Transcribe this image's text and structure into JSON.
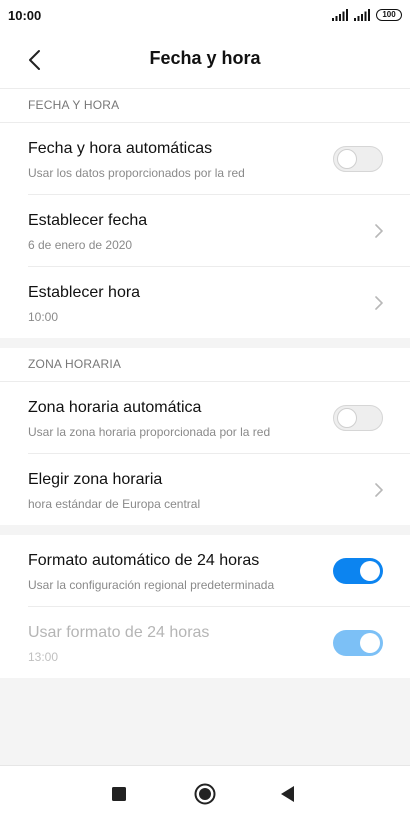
{
  "status_bar": {
    "time": "10:00",
    "battery": "100"
  },
  "header": {
    "title": "Fecha y hora",
    "back_icon": "chevron-left-icon"
  },
  "sections": {
    "date_time": {
      "header": "FECHA Y HORA",
      "auto_date_time": {
        "title": "Fecha y hora automáticas",
        "subtitle": "Usar los datos proporcionados por la red",
        "enabled": false
      },
      "set_date": {
        "title": "Establecer fecha",
        "value": "6 de enero de 2020"
      },
      "set_time": {
        "title": "Establecer hora",
        "value": "10:00"
      }
    },
    "time_zone": {
      "header": "ZONA HORARIA",
      "auto_time_zone": {
        "title": "Zona horaria automática",
        "subtitle": "Usar la zona horaria proporcionada por la red",
        "enabled": false
      },
      "choose_time_zone": {
        "title": "Elegir zona horaria",
        "value": "hora estándar de Europa central"
      }
    },
    "format": {
      "auto_24h": {
        "title": "Formato automático de 24 horas",
        "subtitle": "Usar la configuración regional predeterminada",
        "enabled": true
      },
      "use_24h": {
        "title": "Usar formato de 24 horas",
        "value": "13:00",
        "enabled": true,
        "disabled_row": true
      }
    }
  },
  "colors": {
    "accent": "#0c84f0",
    "accent_disabled": "#7cc0f6",
    "background": "#f4f4f4"
  },
  "nav_bar": {
    "recents_icon": "square-icon",
    "home_icon": "circle-home-icon",
    "back_icon": "triangle-back-icon"
  }
}
